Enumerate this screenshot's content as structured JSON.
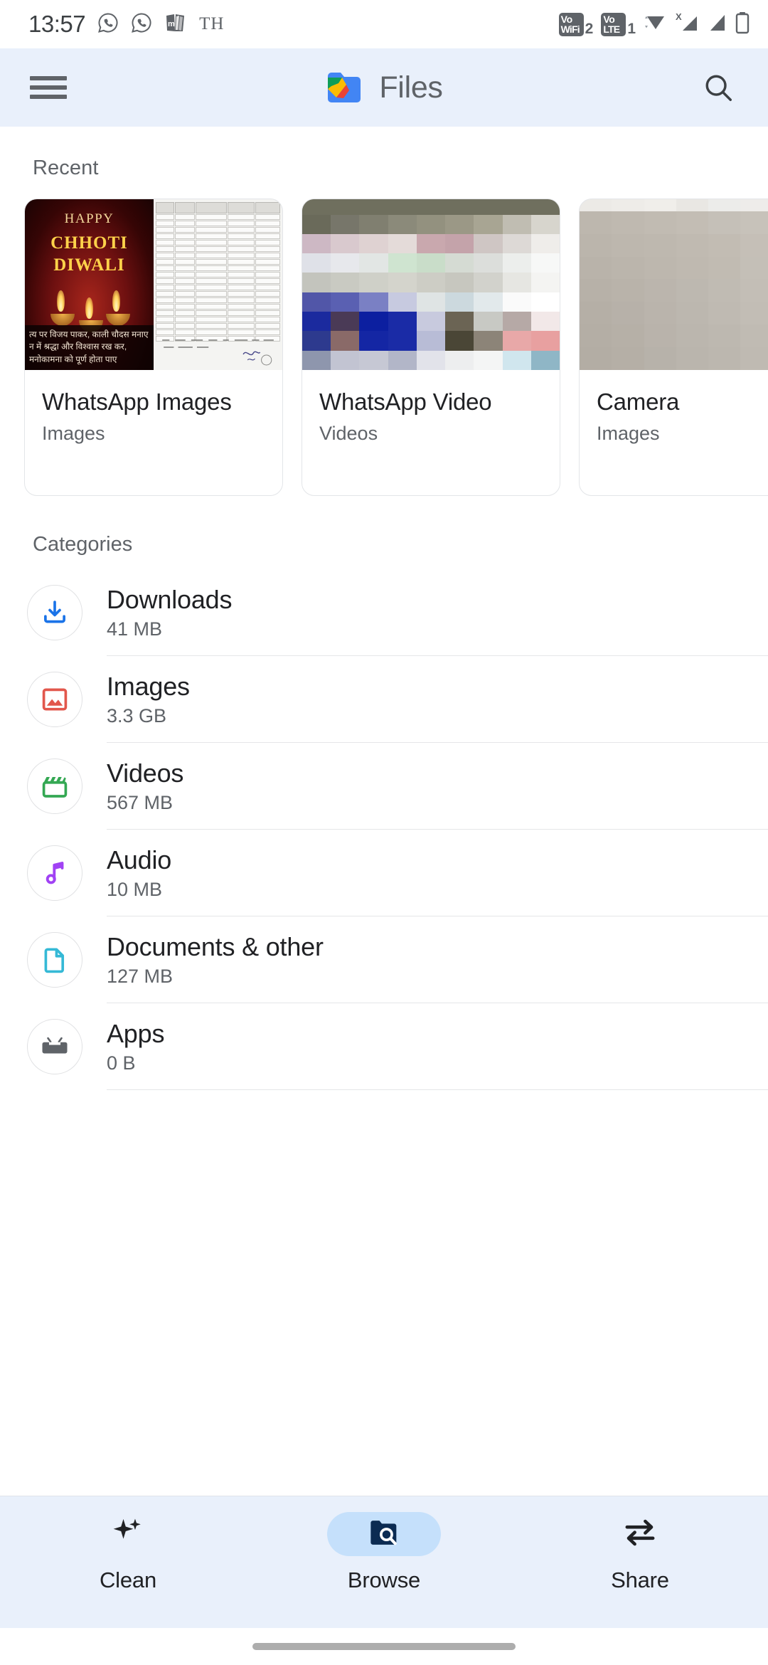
{
  "status_bar": {
    "time": "13:57",
    "left_icons": [
      "whatsapp-icon",
      "whatsapp-icon",
      "bookmyshow-icon"
    ],
    "locale_badge": "TH",
    "right_icons": [
      {
        "name": "volte-wifi-badge",
        "line1": "Vo",
        "line2": "WiFi",
        "sim": "2"
      },
      {
        "name": "volte-badge",
        "line1": "Vo",
        "line2": "LTE",
        "sim": "1"
      },
      {
        "name": "wifi-icon"
      },
      {
        "name": "signal-x-icon",
        "label": "X"
      },
      {
        "name": "signal-icon"
      },
      {
        "name": "battery-icon"
      }
    ]
  },
  "app_bar": {
    "menu_icon": "hamburger-menu-icon",
    "logo": "files-app-logo",
    "title": "Files",
    "search_icon": "search-icon"
  },
  "recent": {
    "heading": "Recent",
    "cards": [
      {
        "title": "WhatsApp Images",
        "subtitle": "Images",
        "thumb_type": "diwali-document",
        "diwali": {
          "line1": "HAPPY",
          "line2": "CHHOTI",
          "line3": "DIWALI",
          "caption1": "त्य पर विजय पाकर, काली चौदस मनाए",
          "caption2": "न में श्रद्धा और विश्वास रख कर,",
          "caption3": "मनोकामना को पूर्ण होता पाए"
        }
      },
      {
        "title": "WhatsApp Video",
        "subtitle": "Videos",
        "thumb_type": "pixelated-video"
      },
      {
        "title": "Camera",
        "subtitle": "Images",
        "thumb_type": "pixelated-beige"
      }
    ]
  },
  "categories": {
    "heading": "Categories",
    "items": [
      {
        "label": "Downloads",
        "size": "41 MB",
        "icon": "download-icon",
        "color": "#1a73e8"
      },
      {
        "label": "Images",
        "size": "3.3 GB",
        "icon": "image-icon",
        "color": "#e2574c"
      },
      {
        "label": "Videos",
        "size": "567 MB",
        "icon": "video-clapper-icon",
        "color": "#34a853"
      },
      {
        "label": "Audio",
        "size": "10 MB",
        "icon": "music-note-icon",
        "color": "#a142f4"
      },
      {
        "label": "Documents & other",
        "size": "127 MB",
        "icon": "document-icon",
        "color": "#35b9d6"
      },
      {
        "label": "Apps",
        "size": "0 B",
        "icon": "android-robot-icon",
        "color": "#5f6368"
      }
    ]
  },
  "bottom_nav": {
    "items": [
      {
        "label": "Clean",
        "icon": "sparkle-icon",
        "active": false
      },
      {
        "label": "Browse",
        "icon": "folder-search-icon",
        "active": true
      },
      {
        "label": "Share",
        "icon": "swap-arrows-icon",
        "active": false
      }
    ]
  },
  "colors": {
    "app_bar_bg": "#e9f0fb",
    "nav_bg": "#e9f0fb",
    "nav_active_pill": "#c5e0fb",
    "nav_active_icon": "#0b2b52",
    "text_primary": "#202124",
    "text_secondary": "#5f6368"
  }
}
